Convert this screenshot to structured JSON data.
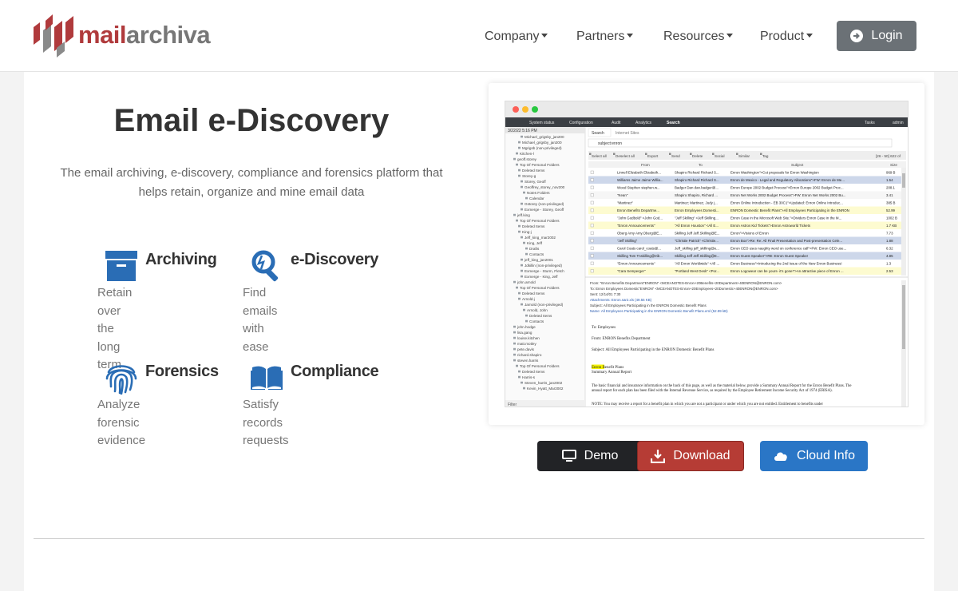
{
  "brand": {
    "part1": "mail",
    "part2": "archiva",
    "accent": "#b03a3c"
  },
  "nav": {
    "items": [
      "Company",
      "Partners",
      "Resources",
      "Product"
    ],
    "login": "Login"
  },
  "hero": {
    "title": "Email e-Discovery",
    "subtitle": "The email archiving, e-discovery, compliance and forensics platform that helps retain, organize and mine email data"
  },
  "features": [
    {
      "icon": "archive-box-icon",
      "title": "Archiving",
      "desc": "Retain over\nthe long term"
    },
    {
      "icon": "search-magnifier-icon",
      "title": "e-Discovery",
      "desc": "Find emails\nwith ease"
    },
    {
      "icon": "fingerprint-icon",
      "title": "Forensics",
      "desc": "Analyze\nforensic\nevidence"
    },
    {
      "icon": "open-book-icon",
      "title": "Compliance",
      "desc": "Satisfy\nrecords\nrequests"
    }
  ],
  "screenshot": {
    "toolbar": [
      "System status",
      "Configuration",
      "Audit",
      "Analytics",
      "Search",
      "Tasks",
      "admin"
    ],
    "date": "3/22/22 5:16 PM",
    "tabs": [
      "Search",
      "Internet Sites"
    ],
    "query": "subject:enron",
    "actions": [
      "Select all",
      "Deselect all",
      "Export",
      "Send",
      "Delete",
      "Social",
      "Similar",
      "Tag"
    ],
    "counter": "[26 - 50] 622 of",
    "headers": [
      "From",
      "To",
      "Subject",
      "Size"
    ],
    "tree": [
      "Michael_grigsby_jan200",
      "Michael_grigsby_jan200",
      "Mgrigsb (non-privileged)",
      "Kitchen-l",
      "geoff.storey",
      "Top Of Personal Folders",
      "Deleted Items",
      "Storey-g",
      "Storey, Geoff",
      "Geoffrey_storey_nov200",
      "Notes Folders",
      "Calendar",
      "Gstorey (non-privileged)",
      "Exmerge - Storey, Geoff",
      "jeff.king",
      "Top Of Personal Folders",
      "Deleted Items",
      "King-j",
      "Jeff_king_mar2002",
      "King, Jeff",
      "Drafts",
      "Contacts",
      "jeff_king_jan2001",
      "Jdkillin (non-privileged)",
      "Exmerge - Sturm, Fletch",
      "Exmerge - King, Jeff",
      "john.arnold",
      "Top Of Personal Folders",
      "Deleted Items",
      "Arnold-j",
      "Jarnold (non-privileged)",
      "Arnold, John",
      "Deleted Items",
      "Contacts",
      "john.hodge",
      "lisa.gang",
      "louise.kitchen",
      "matt.motley",
      "pete.davis",
      "richard.shapiro",
      "steven.harris",
      "Top Of Personal Folders",
      "Deleted Items",
      "Harris-s",
      "Steven_harris_jan2002",
      "Kevin_Hyatt_Mar2002"
    ],
    "rows": [
      {
        "from": "Linnell Elizabeth Elizabeth...",
        "to": "Shapiro Richard Richard S...",
        "subject": "Enron Washington\">Cut proposals for Enron Washington",
        "size": "969 B"
      },
      {
        "from": "Williams Jaime Jaime Willia...",
        "to": "Shapiro Richard Richard S...",
        "subject": "Enron de Mexico - Legal and Regulatory Allocations\">FW: Enron de Me...",
        "size": "1.54"
      },
      {
        "from": "Wood Stephen stephen.w...",
        "to": "Badger Dan dan.badger@...",
        "subject": "Enron Europe 2002 Budget Process\">Enron Europe 2002 Budget Proc...",
        "size": "208.1"
      },
      {
        "from": "\"Kean\"",
        "to": "Shapiro Shapiro, Richard ...",
        "subject": "Enron Net Works 2002 Budget Process\">FW: Enron Net Works 2002 Bu...",
        "size": "3.41"
      },
      {
        "from": "\"Martinez\"",
        "to": "Martinez; Martinez, Judy j...",
        "subject": "Enron Online Introduction - EB 30C1\">Updated: Enron Online Introduc...",
        "size": "385 B"
      },
      {
        "from": "Enron Benefits Departme...",
        "to": "Enron Employees Domesti...",
        "subject": "ENRON Domestic Benefit Plans\">All Employees Participating in the ENRON",
        "size": "52.99"
      },
      {
        "from": "\"John Godbold\" <John God...",
        "to": "\"Jeff Skilling\" <Jeff Skilling...",
        "subject": "Enron Case in the Microsoft Web Site.\">Dividers Enron Case in the M...",
        "size": "1002 B"
      },
      {
        "from": "\"Enron Announcements\"",
        "to": "\"All Enron Houston\" <All E...",
        "subject": "Enron Astros Kid Tickets\">Enron Astroworld Tickets",
        "size": "1.7 KB"
      },
      {
        "from": "Oberg Amy Amy.Oberg@E...",
        "to": "Skilling Jeff Jeff.Skilling@E...",
        "subject": "Enron\">Visions of Enron",
        "size": "7.73"
      },
      {
        "from": "\"Jeff Skilling\"",
        "to": "\"Christie Patrick\" <Christie...",
        "subject": "Enron Box\">Re: Re: All Final Presentation and Post-presentation Cele...",
        "size": "1.88"
      },
      {
        "from": "Carol Coats carol_coats@...",
        "to": "Jeff_skilling jeff_skilling@e...",
        "subject": "Enron CEO uses naughty word on conference call\">FW: Enron CEO use...",
        "size": "6.32"
      },
      {
        "from": "Skilling Tom Tnskilling@trib...",
        "to": "Skilling Jeff Jeff.Skilling@E...",
        "subject": "Enron Guest Speaker\">RE: Enron Guest Speaker",
        "size": "4.85"
      },
      {
        "from": "\"Enron Announcements\"",
        "to": "\"All Enron Worldwide\" <All ...",
        "subject": "Enron Business\">Introducing the 2nd Issue of the New Enron Business!",
        "size": "1.3"
      },
      {
        "from": "\"Cara Semperger\"",
        "to": "\"Portland West Desk\" <Por...",
        "subject": "Enron Logowear can be yours- it's gone!\">An attractive piece of Enron ...",
        "size": "2.53"
      }
    ],
    "preview": {
      "from": "From: \"Enron Benefits Department\"ENRON\" <MCEANOTES-Enron+20Benefits+20Department+40ENRON@ENRON.com>",
      "to": "To: Enron Employees Domestic\"ENRON\" <MCEANOTES-Enron+20Employees+20Domestic+40ENRON@ENRON.com>",
      "sent": "Sent: 12/14/01 7:30",
      "attach": "Attachments: Enron.sar2.xls (49.55 KB)",
      "subject": "Subject: All Employees Participating in the ENRON Domestic Benefit Plans",
      "name": "Name: All Employees Participating in the ENRON Domestic Benefit Plans.eml (52.99 kB)",
      "body_to": "To:    Employees",
      "body_from": "From:    ENRON Benefits Department",
      "body_subject": "Subject:    All Employees Participating in the ENRON Domestic Benefit Plans",
      "b1": "Enron Benefit Plans",
      "b2": "Summary Annual Report",
      "b3": "The basic financial and insurance information on the back of this page, as well as the material below, provide a Summary Annual Report for the Enron Benefit Plans. The annual report for each plan has been filed with the Internal Revenue Service, as required by the Employee Retirement Income Security Act of 1974 (ERISA).",
      "b4": "NOTE: You may receive a report for a benefit plan in which you are not a participant or under which you are not entitled. Entitlement to benefits under"
    },
    "filter": "Filter"
  },
  "buttons": [
    {
      "label": "Demo",
      "color": "#222326",
      "icon": "monitor-icon"
    },
    {
      "label": "Download",
      "color": "#b63c35",
      "icon": "download-icon"
    },
    {
      "label": "Cloud Info",
      "color": "#2a76c6",
      "icon": "cloud-icon"
    }
  ],
  "colors": {
    "blue": "#2a6db5",
    "highlight": "#f6f400"
  }
}
